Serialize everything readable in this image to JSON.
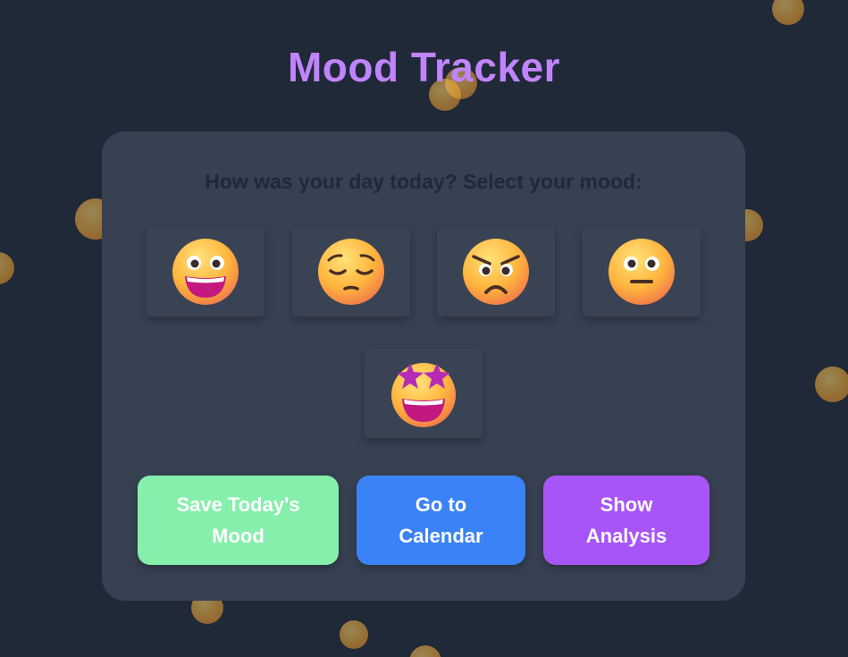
{
  "app": {
    "title": "Mood Tracker"
  },
  "mood_card": {
    "prompt": "How was your day today? Select your mood:",
    "moods": [
      {
        "id": "happy",
        "icon": "grinning-face-icon"
      },
      {
        "id": "sad",
        "icon": "pensive-face-icon"
      },
      {
        "id": "angry",
        "icon": "angry-face-icon"
      },
      {
        "id": "neutral",
        "icon": "neutral-face-icon"
      },
      {
        "id": "excited",
        "icon": "star-struck-face-icon"
      }
    ]
  },
  "actions": {
    "save_label": "Save Today's Mood",
    "calendar_label": "Go to Calendar",
    "analysis_label": "Show Analysis"
  },
  "colors": {
    "background": "#1f2937",
    "card": "#374151",
    "title": "#c084fc",
    "save": "#86efac",
    "calendar": "#3b82f6",
    "analysis": "#a855f7"
  }
}
